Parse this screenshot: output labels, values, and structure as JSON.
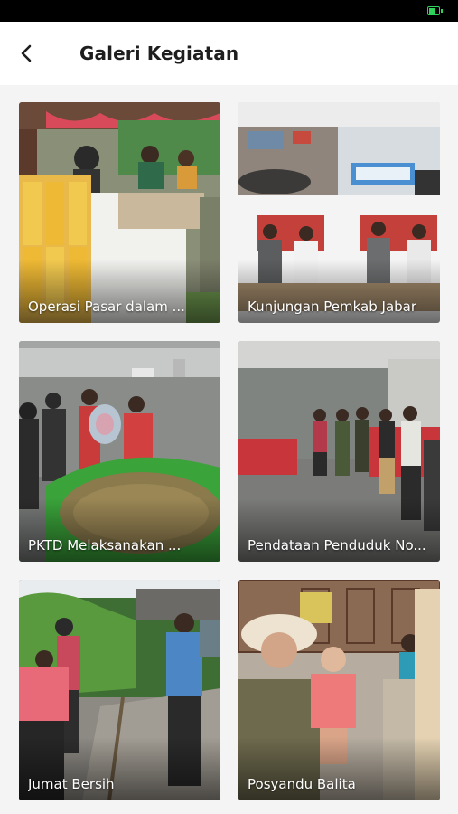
{
  "header": {
    "title": "Galeri Kegiatan",
    "back_icon": "arrow-left-icon"
  },
  "status_bar": {
    "battery_icon": "battery-charging-icon",
    "battery_color": "#2fd35b"
  },
  "gallery": {
    "items": [
      {
        "caption": "Operasi Pasar dalam ..."
      },
      {
        "caption": "Kunjungan Pemkab Jabar"
      },
      {
        "caption": "PKTD Melaksanakan ..."
      },
      {
        "caption": "Pendataan Penduduk No..."
      },
      {
        "caption": "Jumat Bersih"
      },
      {
        "caption": "Posyandu Balita"
      }
    ]
  }
}
